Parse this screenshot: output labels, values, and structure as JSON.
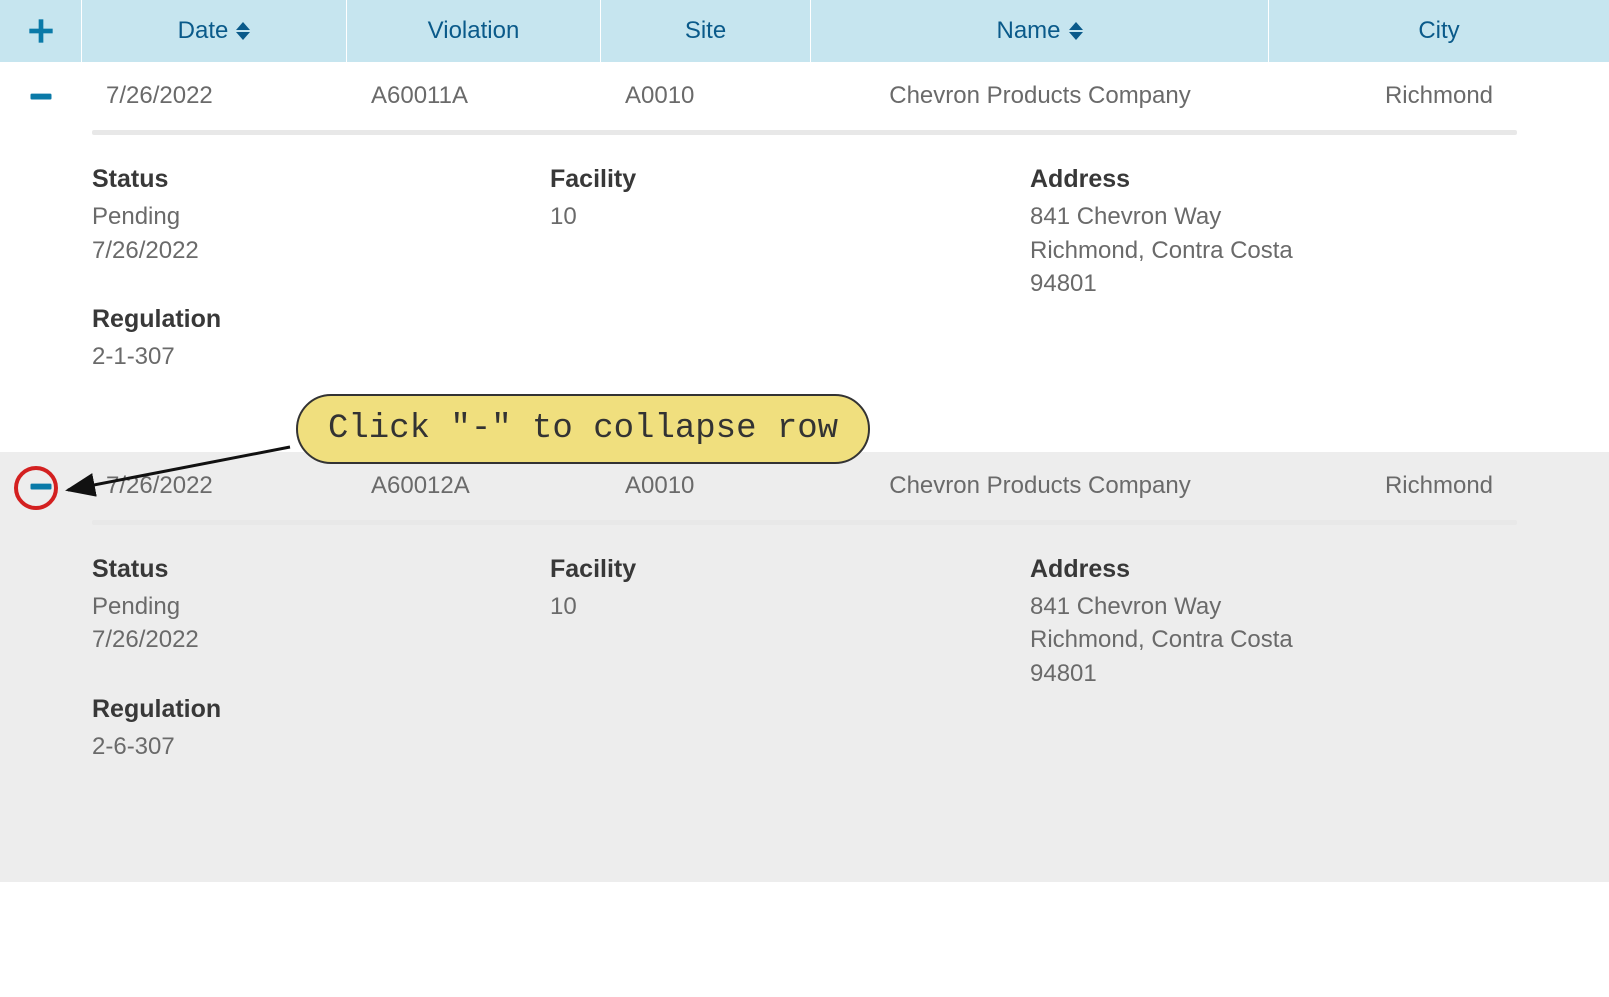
{
  "headers": {
    "date": "Date",
    "violation": "Violation",
    "site": "Site",
    "name": "Name",
    "city": "City"
  },
  "rows": [
    {
      "date": "7/26/2022",
      "violation": "A60011A",
      "site": "A0010",
      "name": "Chevron Products Company",
      "city": "Richmond",
      "details": {
        "status_label": "Status",
        "status_value": "Pending",
        "status_date": "7/26/2022",
        "facility_label": "Facility",
        "facility_value": "10",
        "address_label": "Address",
        "address_line1": "841 Chevron Way",
        "address_line2": "Richmond, Contra Costa",
        "address_line3": "94801",
        "regulation_label": "Regulation",
        "regulation_value": "2-1-307"
      }
    },
    {
      "date": "7/26/2022",
      "violation": "A60012A",
      "site": "A0010",
      "name": "Chevron Products Company",
      "city": "Richmond",
      "details": {
        "status_label": "Status",
        "status_value": "Pending",
        "status_date": "7/26/2022",
        "facility_label": "Facility",
        "facility_value": "10",
        "address_label": "Address",
        "address_line1": "841 Chevron Way",
        "address_line2": "Richmond, Contra Costa",
        "address_line3": "94801",
        "regulation_label": "Regulation",
        "regulation_value": "2-6-307"
      }
    }
  ],
  "annotation": {
    "callout_text": "Click \"-\" to collapse row"
  }
}
